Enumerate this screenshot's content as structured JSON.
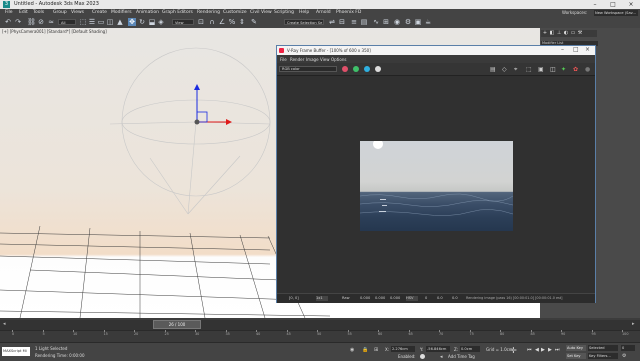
{
  "window": {
    "title": "Untitled - Autodesk 3ds Max 2023",
    "workspaces_label": "Workspaces:",
    "workspace_value": "New Workspace (Sav..."
  },
  "menu": [
    "File",
    "Edit",
    "Tools",
    "Group",
    "Views",
    "Create",
    "Modifiers",
    "Animation",
    "Graph Editors",
    "Rendering",
    "Customize",
    "Civil View",
    "Scripting",
    "Help",
    "Arnold",
    "Phoenix FD"
  ],
  "toolbar": {
    "filter_value": "All",
    "view_value": "View",
    "selection_set_value": "Create Selection Se"
  },
  "viewport": {
    "label": "[+] [PhysCamera001] [Standard*] [Default Shading]"
  },
  "command_panel": {
    "modifier_list": "Modifier List"
  },
  "frame_buffer": {
    "title": "V-Ray Frame Buffer - [100% of 600 x 350]",
    "menu": [
      "File",
      "Render",
      "Image",
      "View",
      "Options"
    ],
    "channel_value": "RGB color",
    "status_coords": "[0, 0]",
    "status_zoom": "1x1",
    "status_mode": "Raw",
    "status_vals": [
      "0.000",
      "0.000",
      "0.000"
    ],
    "status_format": "HSV",
    "status_nums": [
      "0",
      "0.0",
      "0.0"
    ],
    "status_text": "Rendering image (pass 16) [00:00:01.0] [00:00:01.0 est]"
  },
  "timeline": {
    "frame_display": "26 / 100",
    "ticks": [
      "0",
      "5",
      "10",
      "15",
      "20",
      "25",
      "30",
      "35",
      "40",
      "45",
      "50",
      "55",
      "60",
      "65",
      "70",
      "75",
      "80",
      "85",
      "90",
      "95",
      "100"
    ]
  },
  "status_bar": {
    "maxscript": "MAXScript Mi",
    "selection": "1 Light Selected",
    "rendering_time": "Rendering Time: 0:00:00",
    "x_label": "X:",
    "x_value": "2.276cm",
    "y_label": "Y:",
    "y_value": "-56.846cm",
    "z_label": "Z:",
    "z_value": "0.0cm",
    "grid": "Grid = 1.0cm",
    "enabled": "Enabled:",
    "add_time_tag": "Add Time Tag",
    "auto_key": "Auto Key",
    "set_key": "Set Key",
    "selected": "Selected",
    "key_filters": "Key Filters...",
    "frame_value": "0"
  },
  "colors": {
    "accent": "#5b87b6",
    "red_dot": "#e0506a",
    "green_dot": "#3fc06a",
    "blue_dot": "#2fb0e0"
  }
}
